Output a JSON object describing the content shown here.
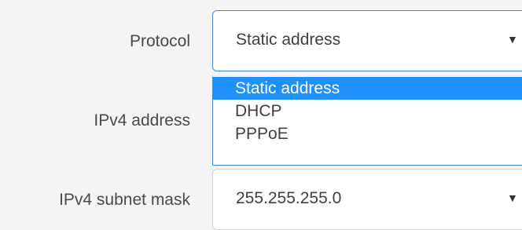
{
  "protocol": {
    "label": "Protocol",
    "selected_value": "Static address",
    "options": [
      "Static address",
      "DHCP",
      "PPPoE"
    ]
  },
  "ipv4_address": {
    "label": "IPv4 address"
  },
  "ipv4_subnet_mask": {
    "label": "IPv4 subnet mask",
    "value": "255.255.255.0"
  },
  "icons": {
    "dropdown_caret": "caret-down-icon",
    "caret_glyph": "▼"
  },
  "colors": {
    "accent": "#1e90ff",
    "focus_border": "#3f8fd8",
    "background": "#f4f4f4",
    "label_text": "#4a4a4a"
  }
}
